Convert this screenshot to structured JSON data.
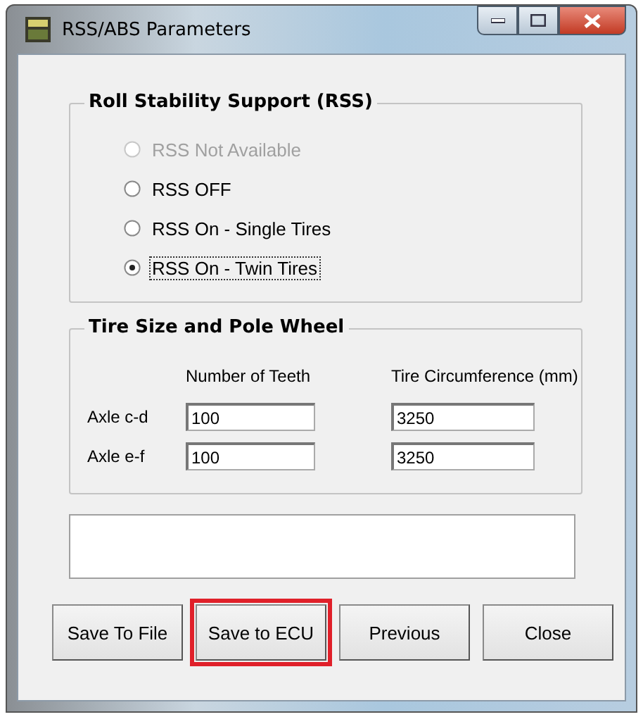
{
  "window": {
    "title": "RSS/ABS Parameters"
  },
  "rss_group": {
    "title": "Roll Stability Support (RSS)",
    "options": [
      {
        "label": "RSS Not Available",
        "selected": false,
        "disabled": true,
        "focused": false
      },
      {
        "label": "RSS OFF",
        "selected": false,
        "disabled": false,
        "focused": false
      },
      {
        "label": "RSS On - Single Tires",
        "selected": false,
        "disabled": false,
        "focused": false
      },
      {
        "label": "RSS On - Twin Tires",
        "selected": true,
        "disabled": false,
        "focused": true
      }
    ]
  },
  "tire_group": {
    "title": "Tire Size and Pole Wheel",
    "columns": [
      "Number of Teeth",
      "Tire Circumference (mm)"
    ],
    "rows": [
      {
        "label": "Axle c-d",
        "teeth": "100",
        "circumference": "3250"
      },
      {
        "label": "Axle e-f",
        "teeth": "100",
        "circumference": "3250"
      }
    ]
  },
  "buttons": [
    {
      "label": "Save To File",
      "highlighted": false
    },
    {
      "label": "Save to ECU",
      "highlighted": true
    },
    {
      "label": "Previous",
      "highlighted": false
    },
    {
      "label": "Close",
      "highlighted": false
    }
  ]
}
